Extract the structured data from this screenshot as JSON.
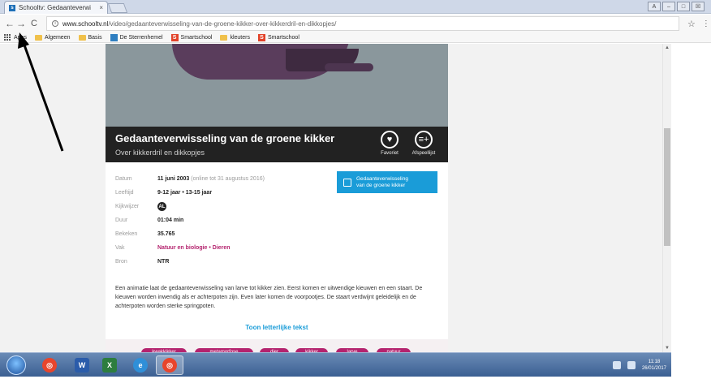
{
  "browser": {
    "tab": {
      "title": "Schooltv: Gedaanteverwi",
      "close": "×"
    },
    "window_controls": {
      "user": "A",
      "minimize": "–",
      "maximize": "□",
      "close": "☒"
    },
    "nav": {
      "back": "←",
      "forward": "→",
      "reload": "C"
    },
    "address": {
      "host": "www.schooltv.nl",
      "path": "/video/gedaanteverwisseling-van-de-groene-kikker-over-kikkerdril-en-dikkopjes/"
    },
    "star": "☆",
    "menu": "⋮",
    "bookmarks": [
      {
        "label": "Apps",
        "icon": "apps-icon"
      },
      {
        "label": "Algemeen",
        "icon": "folder-icon"
      },
      {
        "label": "Basis",
        "icon": "folder-icon"
      },
      {
        "label": "De Sterrenhemel",
        "icon": "sterrenhemel-icon"
      },
      {
        "label": "Smartschool",
        "icon": "smartschool-icon"
      },
      {
        "label": "kleuters",
        "icon": "folder-icon"
      },
      {
        "label": "Smartschool",
        "icon": "smartschool-icon"
      }
    ]
  },
  "video": {
    "title": "Gedaanteverwisseling van de groene kikker",
    "subtitle": "Over kikkerdril en dikkopjes",
    "actions": [
      {
        "label": "Favoriet",
        "icon": "heart-icon",
        "glyph": "♥"
      },
      {
        "label": "Afspeellijst",
        "icon": "playlist-add-icon",
        "glyph": "≡+"
      }
    ]
  },
  "meta": [
    {
      "key": "Datum",
      "value": "11 juni 2003",
      "note": "(online tot 31 augustus 2016)"
    },
    {
      "key": "Leeftijd",
      "value": "9-12 jaar • 13-15 jaar"
    },
    {
      "key": "Kijkwijzer",
      "value": "AL",
      "badge": true
    },
    {
      "key": "Duur",
      "value": "01:04 min"
    },
    {
      "key": "Bekeken",
      "value": "35.765"
    },
    {
      "key": "Vak",
      "value": "Natuur en biologie • Dieren",
      "accent": true
    },
    {
      "key": "Bron",
      "value": "NTR"
    }
  ],
  "transcript_button": {
    "line1": "Gedaanteverwisseling",
    "line2": "van de groene kikker"
  },
  "description": "Een animatie laat de gedaanteverwisseling van larve tot kikker zien. Eerst komen er uitwendige kieuwen en een staart. De kieuwen worden inwendig als er achterpoten zijn. Even later komen de voorpootjes. De staart verdwijnt geleidelijk en de achterpoten worden sterke springpoten.",
  "toggle_text": "Toon letterlijke tekst",
  "tags": [
    "kwakkikker",
    "metamorfose",
    "dier",
    "kikker",
    "larve",
    "natuur"
  ],
  "scrollbar": {
    "up": "▲",
    "down": "▼"
  },
  "taskbar": {
    "items": [
      {
        "name": "chrome",
        "glyph": "◎",
        "color": "#e8452c"
      },
      {
        "name": "word",
        "glyph": "W",
        "color": "#2b5caa"
      },
      {
        "name": "excel",
        "glyph": "X",
        "color": "#2d7d3f"
      },
      {
        "name": "internet-explorer",
        "glyph": "e",
        "color": "#2f8fd8"
      },
      {
        "name": "chrome-active",
        "glyph": "◎",
        "color": "#e8452c"
      }
    ],
    "clock": {
      "time": "11:18",
      "date": "26/01/2017"
    }
  },
  "colors": {
    "accent_blue": "#1a9cd8",
    "accent_pink": "#b4236e",
    "title_bar": "#222222"
  }
}
